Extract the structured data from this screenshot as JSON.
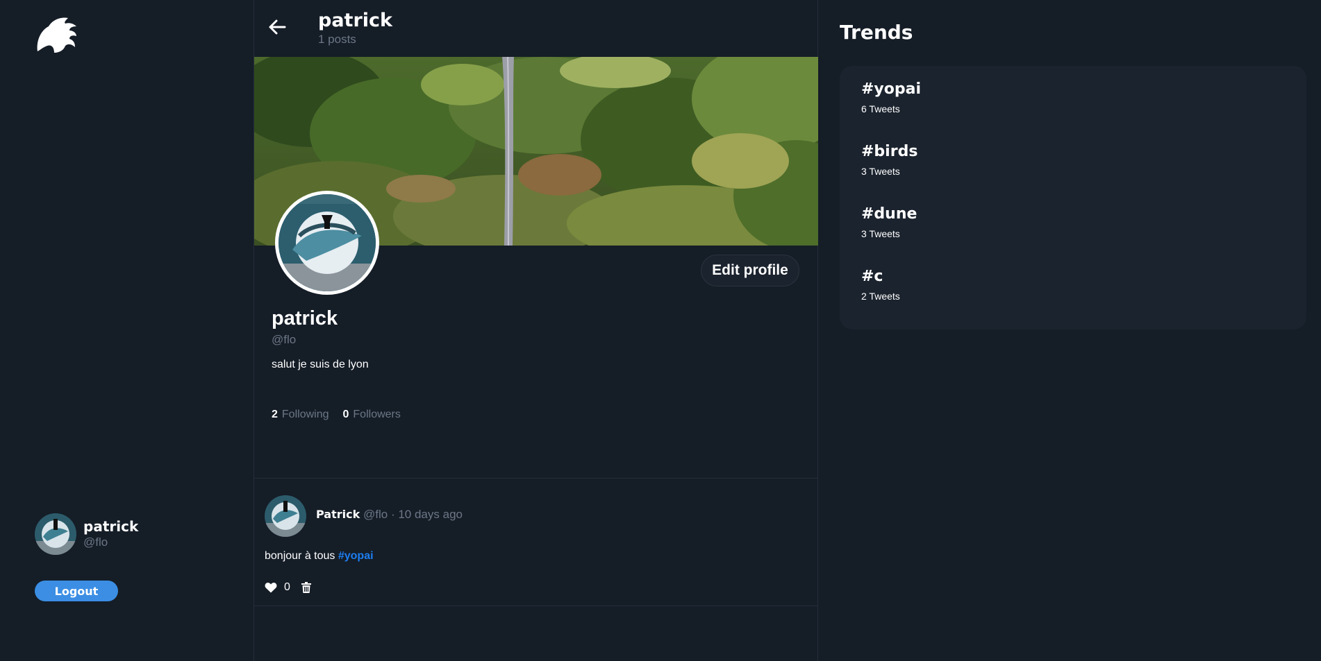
{
  "header": {
    "title": "patrick",
    "post_count": "1 posts"
  },
  "profile": {
    "name": "patrick",
    "handle": "@flo",
    "bio": "salut je suis de lyon",
    "edit_label": "Edit profile",
    "following_count": "2",
    "following_label": "Following",
    "followers_count": "0",
    "followers_label": "Followers"
  },
  "sidebar": {
    "user_name": "patrick",
    "user_handle": "@flo",
    "logout_label": "Logout"
  },
  "posts": [
    {
      "author": "Patrick",
      "handle": "@flo",
      "separator": "·",
      "time": "10 days ago",
      "text": "bonjour à tous ",
      "hashtag": "#yopai",
      "likes": "0"
    }
  ],
  "trends": {
    "title": "Trends",
    "items": [
      {
        "tag": "#yopai",
        "count": "6 Tweets"
      },
      {
        "tag": "#birds",
        "count": "3 Tweets"
      },
      {
        "tag": "#dune",
        "count": "3 Tweets"
      },
      {
        "tag": "#c",
        "count": "2 Tweets"
      }
    ]
  },
  "colors": {
    "background": "#151d27",
    "accent": "#3b8ee4",
    "hashtag": "#1d7ef0",
    "muted": "#6c7787"
  }
}
